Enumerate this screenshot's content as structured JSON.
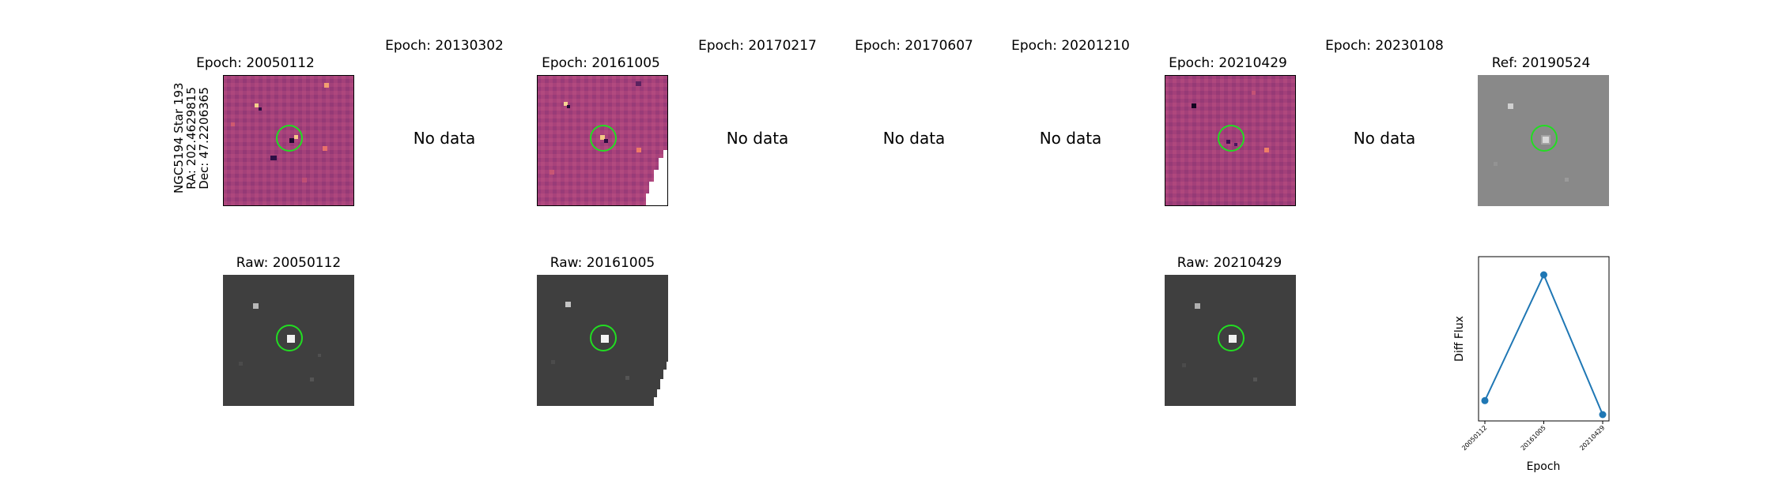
{
  "target": {
    "name": "NGC5194 Star 193",
    "ra": "RA: 202.4629815",
    "dec": "Dec: 47.2206365"
  },
  "epochs": [
    {
      "title": "Epoch: 20050112",
      "has_data": true,
      "raw_title": "Raw: 20050112"
    },
    {
      "title": "Epoch: 20130302",
      "has_data": false,
      "no_data_label": "No data"
    },
    {
      "title": "Epoch: 20161005",
      "has_data": true,
      "raw_title": "Raw: 20161005"
    },
    {
      "title": "Epoch: 20170217",
      "has_data": false,
      "no_data_label": "No data"
    },
    {
      "title": "Epoch: 20170607",
      "has_data": false,
      "no_data_label": "No data"
    },
    {
      "title": "Epoch: 20201210",
      "has_data": false,
      "no_data_label": "No data"
    },
    {
      "title": "Epoch: 20210429",
      "has_data": true,
      "raw_title": "Raw: 20210429"
    },
    {
      "title": "Epoch: 20230108",
      "has_data": false,
      "no_data_label": "No data"
    }
  ],
  "reference": {
    "title": "Ref: 20190524"
  },
  "colors": {
    "circle": "#22dd22",
    "line": "#1f77b4",
    "diff_bg": "#a8407a",
    "raw_bg": "#3e3e3e",
    "ref_bg": "#8a8a8a"
  },
  "chart_data": {
    "type": "line",
    "categories": [
      "20050112",
      "20161005",
      "20210429"
    ],
    "values": [
      0.1,
      1.0,
      0.0
    ],
    "xlabel": "Epoch",
    "ylabel": "Diff Flux",
    "yticks_shown": false
  }
}
